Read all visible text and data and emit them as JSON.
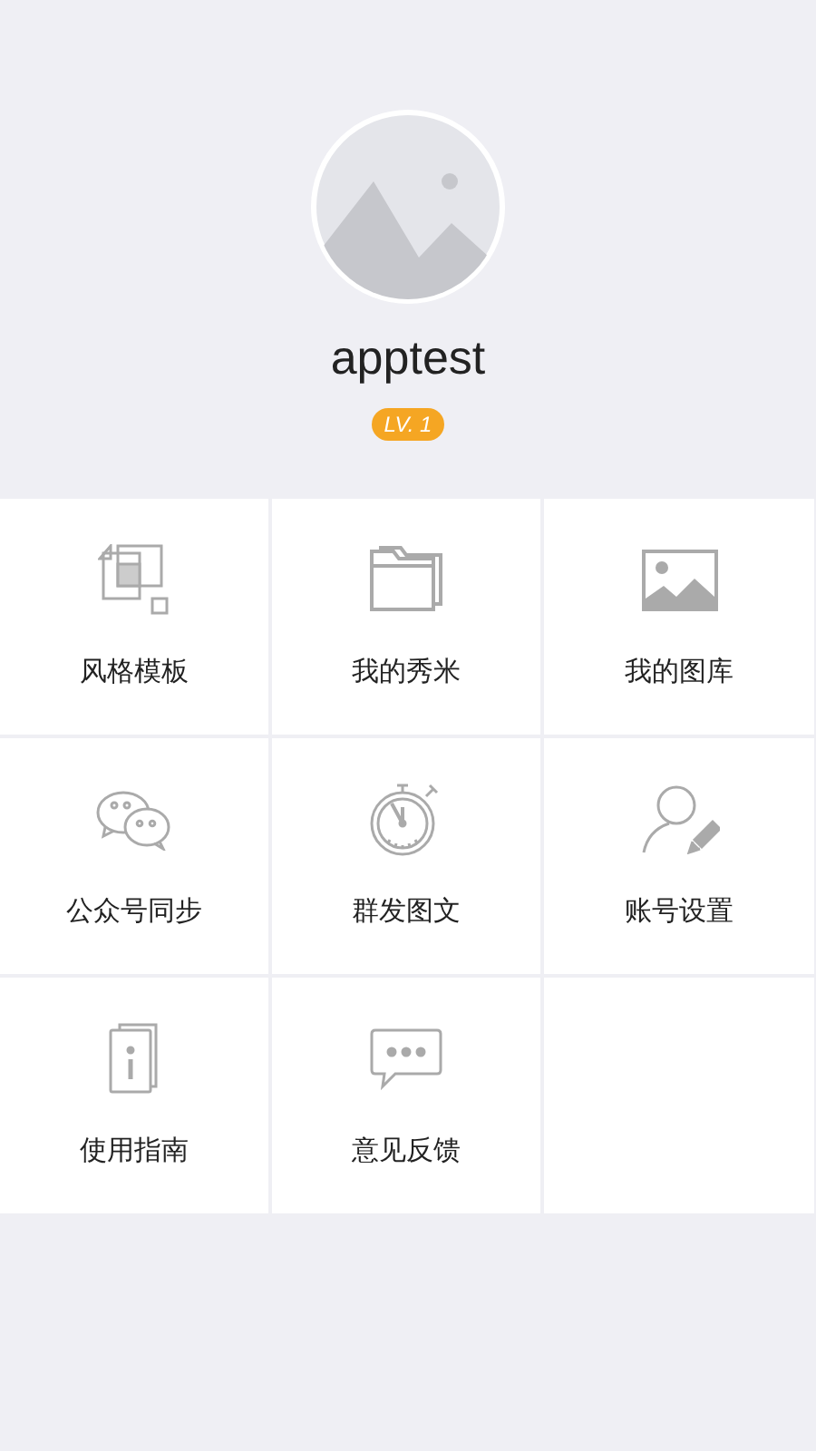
{
  "profile": {
    "username": "apptest",
    "level_badge": "LV. 1"
  },
  "menu": [
    {
      "label": "风格模板",
      "kind": "templates"
    },
    {
      "label": "我的秀米",
      "kind": "folder"
    },
    {
      "label": "我的图库",
      "kind": "gallery"
    },
    {
      "label": "公众号同步",
      "kind": "chat"
    },
    {
      "label": "群发图文",
      "kind": "stopwatch"
    },
    {
      "label": "账号设置",
      "kind": "account"
    },
    {
      "label": "使用指南",
      "kind": "guide"
    },
    {
      "label": "意见反馈",
      "kind": "feedback"
    }
  ]
}
